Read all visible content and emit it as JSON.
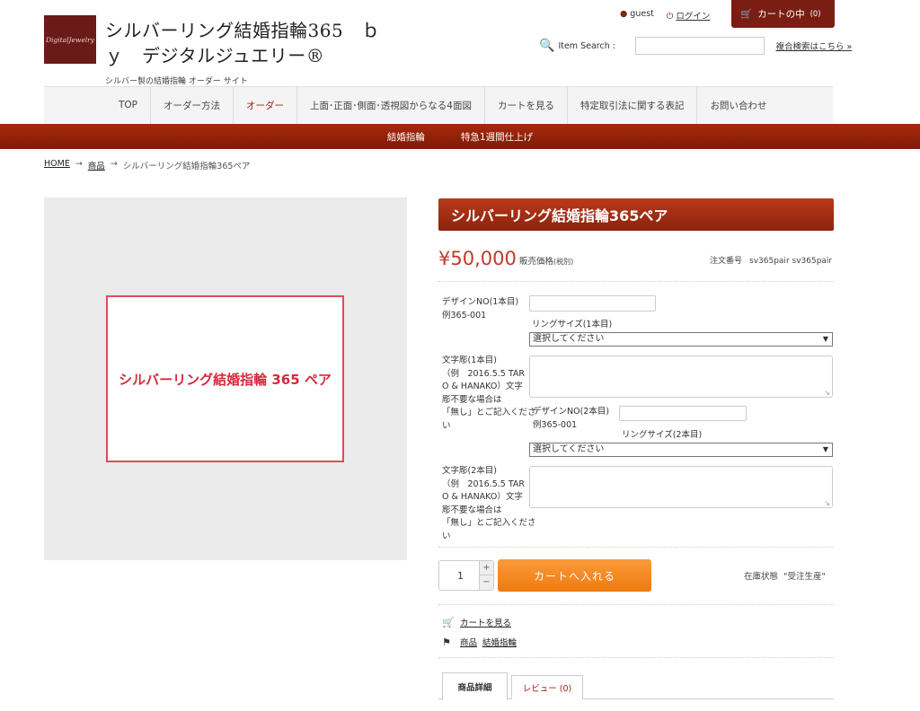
{
  "header": {
    "logo_text": "DigitalJewelry",
    "title": "シルバーリング結婚指輪365　ｂｙ　デジタルジュエリー®",
    "subtitle": "シルバー製の結婚指輪 オーダー サイト",
    "user": "guest",
    "login": "ログイン",
    "cart_label": "カートの中",
    "cart_count": "(0)",
    "search_label": "Item Search :",
    "search_placeholder": "",
    "advanced_search": "複合検索はこちら »"
  },
  "nav": {
    "items": [
      "TOP",
      "オーダー方法",
      "オーダー",
      "上面･正面･側面･透視図からなる4面図",
      "カートを見る",
      "特定取引法に関する表記",
      "お問い合わせ"
    ],
    "active_index": 2
  },
  "subnav": [
    "結婚指輪",
    "特急1週間仕上げ"
  ],
  "breadcrumb": {
    "home": "HOME",
    "sep": "→",
    "category": "商品",
    "current": "シルバーリング結婚指輪365ペア"
  },
  "product": {
    "image_text": "シルバーリング結婚指輪 365 ペア",
    "title": "シルバーリング結婚指輪365ペア",
    "price": "¥50,000",
    "price_label": "販売価格",
    "price_tax": "(税別)",
    "order_no_label": "注文番号",
    "order_no": "sv365pair sv365pair",
    "stock_label": "在庫状態",
    "stock_value": "受注生産",
    "quantity": "1",
    "add_to_cart": "カートへ入れる"
  },
  "form": {
    "design1_label_a": "デザインNO(1本目)",
    "design1_label_b": "例365-001",
    "size1_label": "リングサイズ(1本目)",
    "size1_value": "選択してください",
    "engrave1_lines": [
      "文字彫(1本目)",
      "（例　2016.5.5 TAR",
      "O & HANAKO）文字",
      "彫不要な場合は",
      "「無し」とご記入くださ",
      "い"
    ],
    "design2_label_a": "デザインNO(2本目)",
    "design2_label_b": "例365-001",
    "size2_label": "リングサイズ(2本目)",
    "size2_value": "選択してください",
    "engrave2_lines": [
      "文字彫(2本目)",
      "（例　2016.5.5 TAR",
      "O & HANAKO）文字",
      "彫不要な場合は",
      "「無し」とご記入くださ",
      "い"
    ]
  },
  "links": {
    "view_cart": "カートを見る",
    "category": "商品",
    "subcategory": "結婚指輪"
  },
  "tabs": [
    "商品詳細",
    "レビュー (0)"
  ]
}
